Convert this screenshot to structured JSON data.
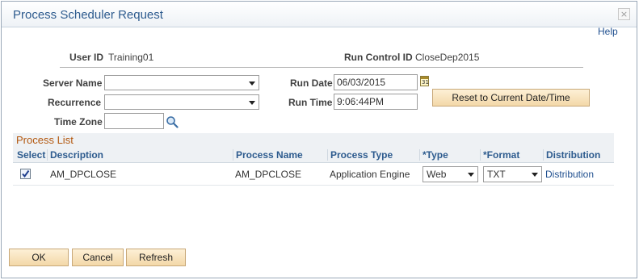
{
  "window": {
    "title": "Process Scheduler Request",
    "close_glyph": "×",
    "help_label": "Help"
  },
  "info": {
    "user_id_label": "User ID",
    "user_id": "Training01",
    "run_control_label": "Run Control ID",
    "run_control": "CloseDep2015"
  },
  "form": {
    "server_name_label": "Server Name",
    "server_name": "",
    "recurrence_label": "Recurrence",
    "recurrence": "",
    "time_zone_label": "Time Zone",
    "time_zone": "",
    "run_date_label": "Run Date",
    "run_date": "06/03/2015",
    "run_time_label": "Run Time",
    "run_time": "9:06:44PM",
    "reset_label": "Reset to Current Date/Time",
    "calendar_icon_text": "31"
  },
  "process_list": {
    "title": "Process List",
    "columns": [
      "Select",
      "Description",
      "Process Name",
      "Process Type",
      "*Type",
      "*Format",
      "Distribution"
    ],
    "rows": [
      {
        "selected": true,
        "description": "AM_DPCLOSE",
        "process_name": "AM_DPCLOSE",
        "process_type": "Application Engine",
        "type": "Web",
        "format": "TXT",
        "distribution": "Distribution"
      }
    ]
  },
  "buttons": {
    "ok": "OK",
    "cancel": "Cancel",
    "refresh": "Refresh"
  },
  "icons": {
    "search": "search-icon",
    "calendar": "calendar-icon",
    "close": "close-icon",
    "checkbox": "check-icon"
  },
  "colors": {
    "title": "#2d5b8e",
    "section": "#b3580f",
    "button": "#f3d8a8",
    "link": "#1f4f8f"
  }
}
